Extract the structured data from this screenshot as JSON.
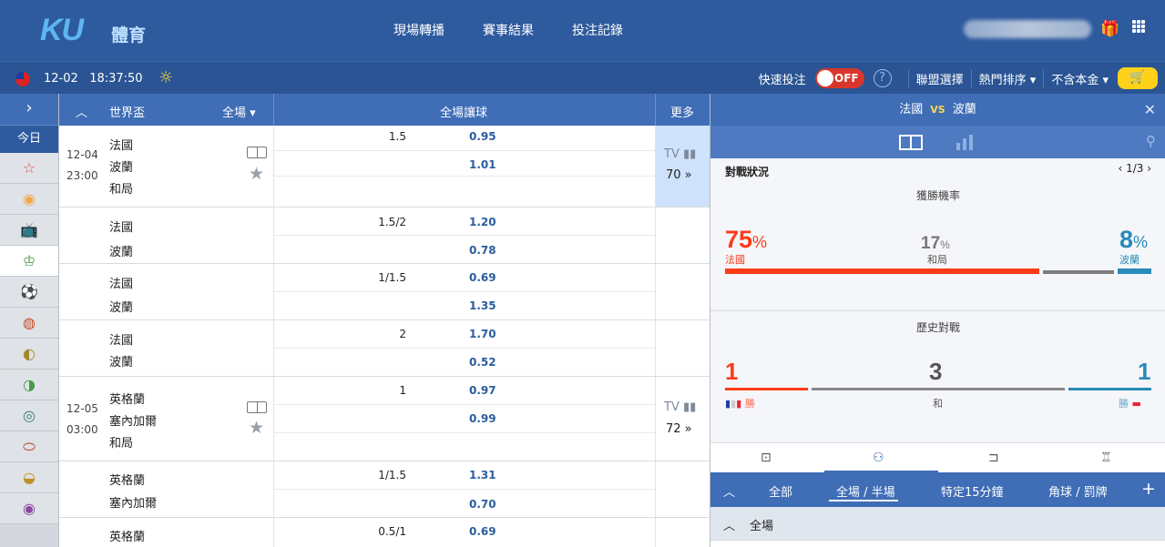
{
  "header": {
    "logo": "KU",
    "logo_sub": "體育",
    "nav": [
      "現場轉播",
      "賽事結果",
      "投注記錄"
    ],
    "gift_icon": "gift-icon",
    "apps_icon": "grid-icon"
  },
  "subbar": {
    "date": "12-02",
    "time": "18:37:50",
    "quick_bet": "快速投注",
    "toggle": "OFF",
    "league_select": "聯盟選擇",
    "sort": "熱門排序",
    "stake": "不含本金",
    "cart_icon": "cart-icon"
  },
  "sidebar": {
    "today": "今日",
    "icons": [
      "star-icon",
      "live-icon",
      "tv-icon",
      "trophy-icon",
      "soccer-icon",
      "basketball-icon",
      "tennis-icon",
      "baseball-icon",
      "rugby-icon",
      "football-icon",
      "volleyball-icon",
      "snooker-icon"
    ]
  },
  "table": {
    "league": "世界盃",
    "period": "全場",
    "market": "全場讓球",
    "more": "更多",
    "groups": [
      {
        "date": "12-04",
        "time": "23:00",
        "teams": [
          "法國",
          "波蘭",
          "和局"
        ],
        "odds": [
          {
            "h": "1.5",
            "p": "0.95"
          },
          {
            "h": "",
            "p": "1.01"
          }
        ],
        "tv": "TV",
        "count": "70",
        "featured": true
      },
      {
        "teams": [
          "法國",
          "波蘭"
        ],
        "odds": [
          {
            "h": "1.5/2",
            "p": "1.20"
          },
          {
            "h": "",
            "p": "0.78"
          }
        ]
      },
      {
        "teams": [
          "法國",
          "波蘭"
        ],
        "odds": [
          {
            "h": "1/1.5",
            "p": "0.69"
          },
          {
            "h": "",
            "p": "1.35"
          }
        ]
      },
      {
        "teams": [
          "法國",
          "波蘭"
        ],
        "odds": [
          {
            "h": "2",
            "p": "1.70"
          },
          {
            "h": "",
            "p": "0.52"
          }
        ]
      },
      {
        "date": "12-05",
        "time": "03:00",
        "teams": [
          "英格蘭",
          "塞內加爾",
          "和局"
        ],
        "odds": [
          {
            "h": "1",
            "p": "0.97"
          },
          {
            "h": "",
            "p": "0.99"
          }
        ],
        "tv": "TV",
        "count": "72",
        "featured": false
      },
      {
        "teams": [
          "英格蘭",
          "塞內加爾"
        ],
        "odds": [
          {
            "h": "1/1.5",
            "p": "1.31"
          },
          {
            "h": "",
            "p": "0.70"
          }
        ]
      },
      {
        "teams": [
          "英格蘭"
        ],
        "odds": [
          {
            "h": "0.5/1",
            "p": "0.69"
          }
        ]
      }
    ]
  },
  "panel": {
    "home": "法國",
    "vs": "VS",
    "away": "波蘭",
    "matchup": "對戰狀況",
    "pager": "1/3",
    "win_prob_title": "獲勝機率",
    "home_pct": "75",
    "draw_pct": "17",
    "away_pct": "8",
    "pct_sign": "%",
    "draw_label": "和局",
    "home_win_fraction": 0.75,
    "history_title": "歷史對戰",
    "hist_home": "1",
    "hist_draw": "3",
    "hist_away": "1",
    "win_label": "勝",
    "draw_short": "和",
    "tabs": [
      "全部",
      "全場 / 半場",
      "特定15分鐘",
      "角球 / 罰牌"
    ],
    "fullcourt": "全場",
    "colors": {
      "home": "#ff3a1a",
      "draw": "#7d7d7d",
      "away": "#2a8ab8",
      "accent": "#3f6db6"
    }
  }
}
